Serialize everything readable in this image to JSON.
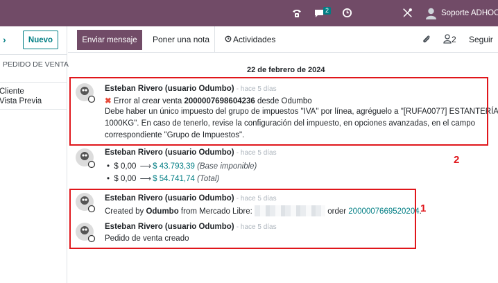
{
  "topbar": {
    "chat_badge": "2",
    "user_name": "Soporte ADHOC"
  },
  "left": {
    "new_button": "Nuevo",
    "column_header": "PEDIDO DE VENTA",
    "row_line1": "Cliente",
    "row_line2": "Vista Previa"
  },
  "toolbar": {
    "send_message": "Enviar mensaje",
    "log_note": "Poner una nota",
    "activities": "Actividades",
    "followers_count": "2",
    "follow": "Seguir"
  },
  "date_separator": "22 de febrero de 2024",
  "messages": [
    {
      "author": "Esteban Rivero (usuario Odumbo)",
      "time": "- hace 5 días",
      "line1_prefix": "Error al crear venta ",
      "line1_bold": "2000007698604236",
      "line1_suffix": " desde Odumbo",
      "line2": "Debe haber un único impuesto del grupo de impuestos \"IVA\" por línea, agréguelo a \"[RUFA0077] ESTANTERÍA",
      "line3": "1000KG\". En caso de tenerlo, revise la configuración del impuesto, en opciones avanzadas, en el campo",
      "line4": "correspondiente \"Grupo de Impuestos\"."
    },
    {
      "author": "Esteban Rivero (usuario Odumbo)",
      "time": "- hace 5 días",
      "change1_old": "$ 0,00",
      "change1_new": "$ 43.793,39",
      "change1_field": "(Base imponible)",
      "change2_old": "$ 0,00",
      "change2_new": "$ 54.741,74",
      "change2_field": "(Total)"
    },
    {
      "author": "Esteban Rivero (usuario Odumbo)",
      "time": "- hace 5 días",
      "text_a": "Created by ",
      "text_b": "Odumbo",
      "text_c": " from Mercado Libre: ",
      "text_d": " order ",
      "order_link": "2000007669520204",
      "text_e": "."
    },
    {
      "author": "Esteban Rivero (usuario Odumbo)",
      "time": "- hace 5 días",
      "text": "Pedido de venta creado"
    }
  ],
  "annotations": {
    "label_1": "1",
    "label_2": "2"
  },
  "colors": {
    "brand": "#714b67",
    "accent": "#017e84",
    "annotation_red": "#e0161b"
  }
}
